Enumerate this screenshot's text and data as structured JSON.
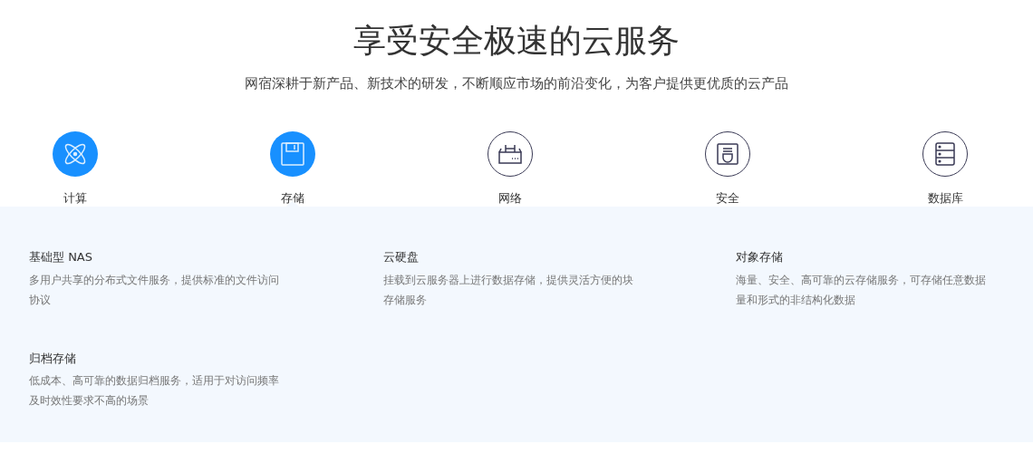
{
  "heading": "享受安全极速的云服务",
  "subheading": "网宿深耕于新产品、新技术的研发，不断顺应市场的前沿变化，为客户提供更优质的云产品",
  "tabs": [
    {
      "label": "计算",
      "kind": "atom",
      "filled": true,
      "selected": false
    },
    {
      "label": "存储",
      "kind": "disk",
      "filled": true,
      "selected": true
    },
    {
      "label": "网络",
      "kind": "router",
      "filled": false,
      "selected": false
    },
    {
      "label": "安全",
      "kind": "shield",
      "filled": false,
      "selected": false
    },
    {
      "label": "数据库",
      "kind": "server",
      "filled": false,
      "selected": false
    }
  ],
  "products": [
    {
      "title": "基础型 NAS",
      "description": "多用户共享的分布式文件服务，提供标准的文件访问协议"
    },
    {
      "title": "云硬盘",
      "description": "挂载到云服务器上进行数据存储，提供灵活方便的块存储服务"
    },
    {
      "title": "对象存储",
      "description": "海量、安全、高可靠的云存储服务，可存储任意数据量和形式的非结构化数据"
    },
    {
      "title": "归档存储",
      "description": "低成本、高可靠的数据归档服务，适用于对访问频率及时效性要求不高的场景"
    }
  ]
}
